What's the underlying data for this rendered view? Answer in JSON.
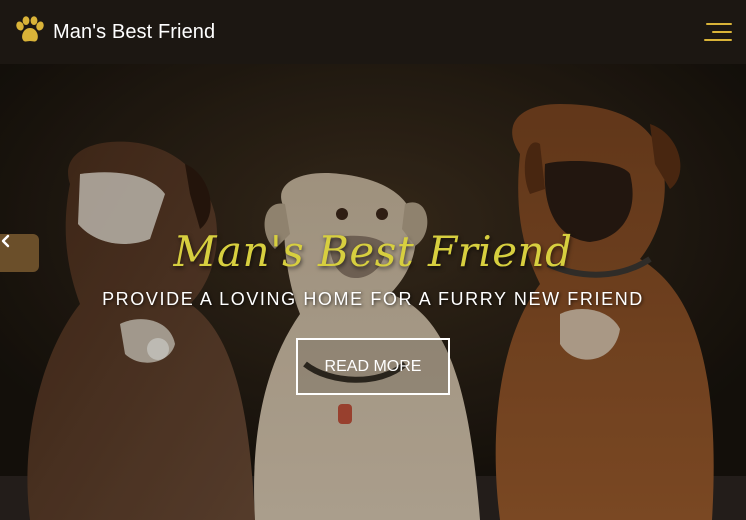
{
  "navbar": {
    "brand_icon": "paw-icon",
    "brand_name": "Man's Best Friend",
    "menu_icon": "hamburger-menu-icon",
    "accent_color": "#d9b338"
  },
  "hero": {
    "script_title": "Man's Best Friend",
    "subtitle": "PROVIDE A LOVING HOME FOR A FURRY NEW FRIEND",
    "cta_label": "READ MORE",
    "prev_icon": "chevron-left-icon",
    "title_color": "#d7cf3f",
    "image": "three-boxer-dogs-photo"
  }
}
